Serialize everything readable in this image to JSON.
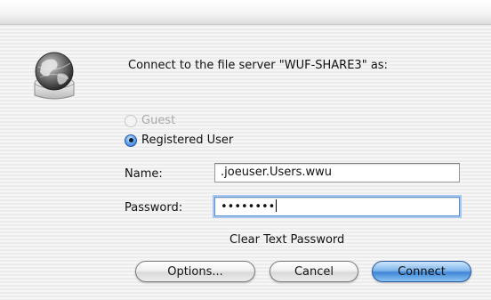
{
  "dialog": {
    "prompt": "Connect to the file server \"WUF-SHARE3\" as:",
    "icon": "network-globe-server-icon"
  },
  "login_type": {
    "guest_label": "Guest",
    "guest_enabled": false,
    "registered_label": "Registered User",
    "selected": "Registered User"
  },
  "fields": {
    "name_label": "Name:",
    "name_value": ".joeuser.Users.wwu",
    "password_label": "Password:",
    "password_value": "••••••••"
  },
  "options_text": "Clear Text Password",
  "buttons": {
    "options": "Options...",
    "cancel": "Cancel",
    "connect": "Connect"
  },
  "colors": {
    "accent": "#3f86d6",
    "background": "#ececec"
  }
}
